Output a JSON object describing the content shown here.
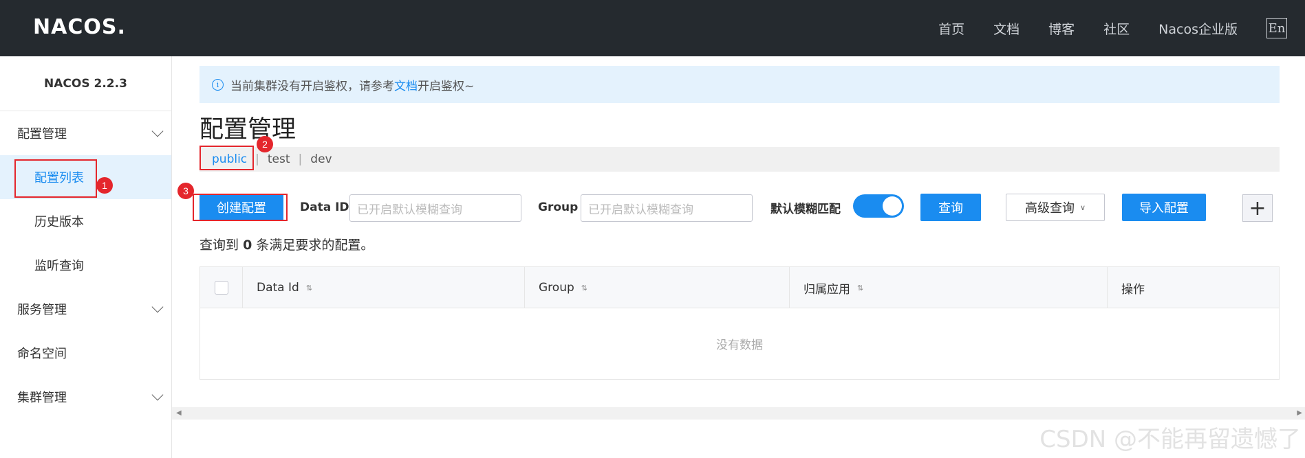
{
  "header": {
    "logo": "NACOS.",
    "nav": [
      "首页",
      "文档",
      "博客",
      "社区",
      "Nacos企业版"
    ],
    "lang": "En"
  },
  "sidebar": {
    "version": "NACOS 2.2.3",
    "config_group": "配置管理",
    "config_items": [
      "配置列表",
      "历史版本",
      "监听查询"
    ],
    "service_group": "服务管理",
    "namespace": "命名空间",
    "cluster_group": "集群管理"
  },
  "notice": {
    "prefix": "当前集群没有开启鉴权，请参考",
    "link": "文档",
    "suffix": "开启鉴权~"
  },
  "page_title": "配置管理",
  "namespaces": [
    {
      "label": "public",
      "active": true
    },
    {
      "label": "test",
      "active": false
    },
    {
      "label": "dev",
      "active": false
    }
  ],
  "toolbar": {
    "create": "创建配置",
    "data_id_label": "Data ID",
    "data_id_placeholder": "已开启默认模糊查询",
    "group_label": "Group",
    "group_placeholder": "已开启默认模糊查询",
    "fuzzy_label": "默认模糊匹配",
    "fuzzy_on": true,
    "query": "查询",
    "advanced": "高级查询",
    "import": "导入配置",
    "plus": "+"
  },
  "result": {
    "prefix": "查询到",
    "count": "0",
    "suffix": "条满足要求的配置。"
  },
  "table": {
    "columns": [
      "Data Id",
      "Group",
      "归属应用",
      "操作"
    ],
    "empty": "没有数据"
  },
  "annotations": [
    "1",
    "2",
    "3"
  ],
  "watermark": "CSDN @不能再留遗憾了",
  "colors": {
    "accent": "#1a8cf0",
    "topbar": "#252a2f",
    "annotation": "#e4262c"
  }
}
